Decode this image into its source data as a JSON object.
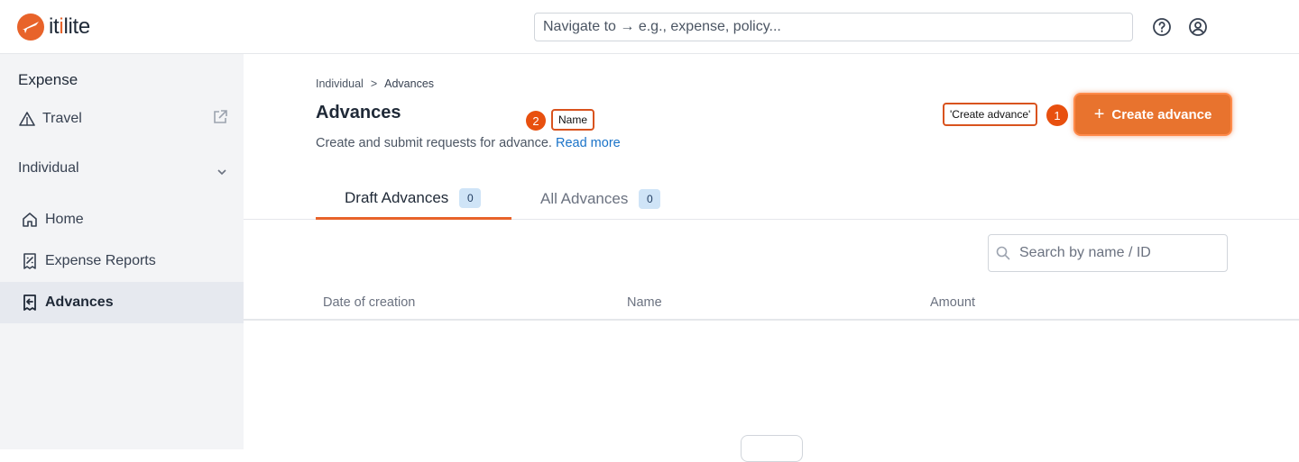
{
  "brand": {
    "name_prefix": "it",
    "name_accent": "i",
    "name_suffix": "lite",
    "color": "#e8632a"
  },
  "header": {
    "nav_placeholder": "Navigate to → e.g., expense, policy...",
    "icons": [
      "help-icon",
      "user-icon"
    ]
  },
  "sidebar": {
    "heading": "Expense",
    "travel_label": "Travel",
    "section_label": "Individual",
    "items": [
      {
        "label": "Home",
        "icon": "home-icon",
        "active": false
      },
      {
        "label": "Expense Reports",
        "icon": "receipt-icon",
        "active": false
      },
      {
        "label": "Advances",
        "icon": "advance-icon",
        "active": true
      }
    ]
  },
  "breadcrumb": {
    "parent": "Individual",
    "separator": ">",
    "current": "Advances"
  },
  "page": {
    "title": "Advances",
    "subtitle": "Create and submit requests for advance.",
    "read_more": "Read more"
  },
  "annotations": {
    "one": {
      "number": "1",
      "label": "'Create advance'"
    },
    "two": {
      "number": "2",
      "label": "Name"
    }
  },
  "actions": {
    "create_label": "Create advance"
  },
  "tabs": [
    {
      "label": "Draft Advances",
      "count": "0",
      "active": true
    },
    {
      "label": "All Advances",
      "count": "0",
      "active": false
    }
  ],
  "search": {
    "placeholder": "Search by name / ID"
  },
  "table": {
    "columns": [
      "Date of creation",
      "Name",
      "Amount"
    ],
    "rows": []
  }
}
